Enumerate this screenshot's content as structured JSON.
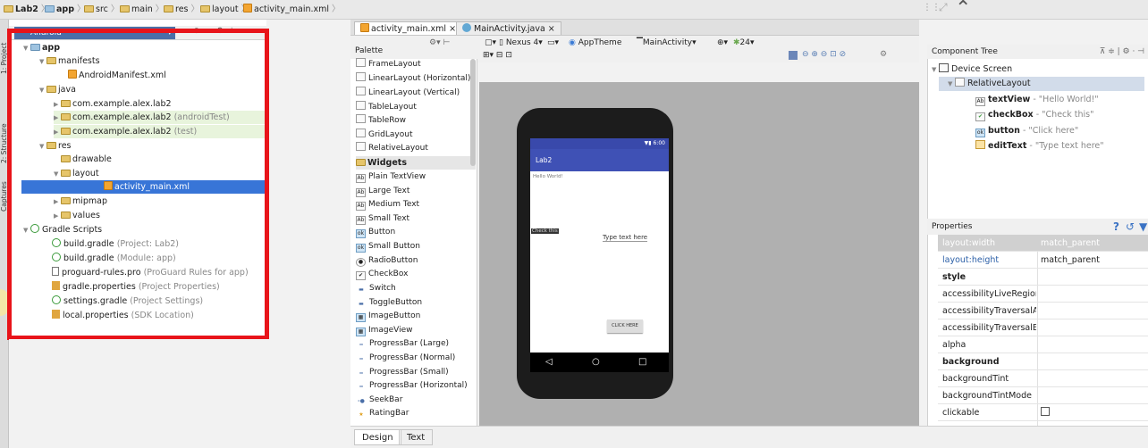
{
  "breadcrumb": [
    "Lab2",
    "app",
    "src",
    "main",
    "res",
    "layout",
    "activity_main.xml"
  ],
  "project_panel": {
    "view_mode": "Android",
    "tree": [
      {
        "label": "app",
        "bold": true
      },
      {
        "label": "manifests"
      },
      {
        "label": "AndroidManifest.xml"
      },
      {
        "label": "java"
      },
      {
        "label": "com.example.alex.lab2"
      },
      {
        "label": "com.example.alex.lab2",
        "suffix": "(androidTest)"
      },
      {
        "label": "com.example.alex.lab2",
        "suffix": "(test)"
      },
      {
        "label": "res"
      },
      {
        "label": "drawable"
      },
      {
        "label": "layout"
      },
      {
        "label": "activity_main.xml"
      },
      {
        "label": "mipmap"
      },
      {
        "label": "values"
      },
      {
        "label": "Gradle Scripts"
      },
      {
        "label": "build.gradle",
        "suffix": "(Project: Lab2)"
      },
      {
        "label": "build.gradle",
        "suffix": "(Module: app)"
      },
      {
        "label": "proguard-rules.pro",
        "suffix": "(ProGuard Rules for app)"
      },
      {
        "label": "gradle.properties",
        "suffix": "(Project Properties)"
      },
      {
        "label": "settings.gradle",
        "suffix": "(Project Settings)"
      },
      {
        "label": "local.properties",
        "suffix": "(SDK Location)"
      }
    ]
  },
  "side_tabs": [
    "1: Project",
    "2: Structure",
    "Captures"
  ],
  "editor_tabs": [
    "activity_main.xml",
    "MainActivity.java"
  ],
  "palette": {
    "title": "Palette",
    "items": [
      "FrameLayout",
      "LinearLayout (Horizontal)",
      "LinearLayout (Vertical)",
      "TableLayout",
      "TableRow",
      "GridLayout",
      "RelativeLayout"
    ],
    "category_widgets": "Widgets",
    "widgets": [
      "Plain TextView",
      "Large Text",
      "Medium Text",
      "Small Text",
      "Button",
      "Small Button",
      "RadioButton",
      "CheckBox",
      "Switch",
      "ToggleButton",
      "ImageButton",
      "ImageView",
      "ProgressBar (Large)",
      "ProgressBar (Normal)",
      "ProgressBar (Small)",
      "ProgressBar (Horizontal)",
      "SeekBar",
      "RatingBar"
    ]
  },
  "design_toolbar": {
    "device": "Nexus 4",
    "theme": "AppTheme",
    "activity": "MainActivity",
    "api": "24"
  },
  "phone": {
    "status_time": "6:00",
    "app_title": "Lab2",
    "hello": "Hello World!",
    "checkbox": "Check this",
    "edittext": "Type text here",
    "button": "CLICK HERE"
  },
  "bottom_tabs": [
    "Design",
    "Text"
  ],
  "component_tree": {
    "title": "Component Tree",
    "items": [
      {
        "label": "Device Screen"
      },
      {
        "label": "RelativeLayout"
      },
      {
        "label": "textView",
        "desc": "- \"Hello World!\""
      },
      {
        "label": "checkBox",
        "desc": "- \"Check this\""
      },
      {
        "label": "button",
        "desc": "- \"Click here\""
      },
      {
        "label": "editText",
        "desc": "- \"Type text here\""
      }
    ]
  },
  "properties": {
    "title": "Properties",
    "rows": [
      {
        "name": "layout:width",
        "value": "match_parent"
      },
      {
        "name": "layout:height",
        "value": "match_parent"
      },
      {
        "name": "style",
        "value": ""
      },
      {
        "name": "accessibilityLiveRegion",
        "value": ""
      },
      {
        "name": "accessibilityTraversalAfte",
        "value": ""
      },
      {
        "name": "accessibilityTraversalBefc",
        "value": ""
      },
      {
        "name": "alpha",
        "value": ""
      },
      {
        "name": "background",
        "value": ""
      },
      {
        "name": "backgroundTint",
        "value": ""
      },
      {
        "name": "backgroundTintMode",
        "value": ""
      },
      {
        "name": "clickable",
        "value": ""
      }
    ]
  },
  "colors": {
    "highlight": "#3875d7",
    "red_box": "#e8141a",
    "app_bar": "#3f51b5"
  }
}
